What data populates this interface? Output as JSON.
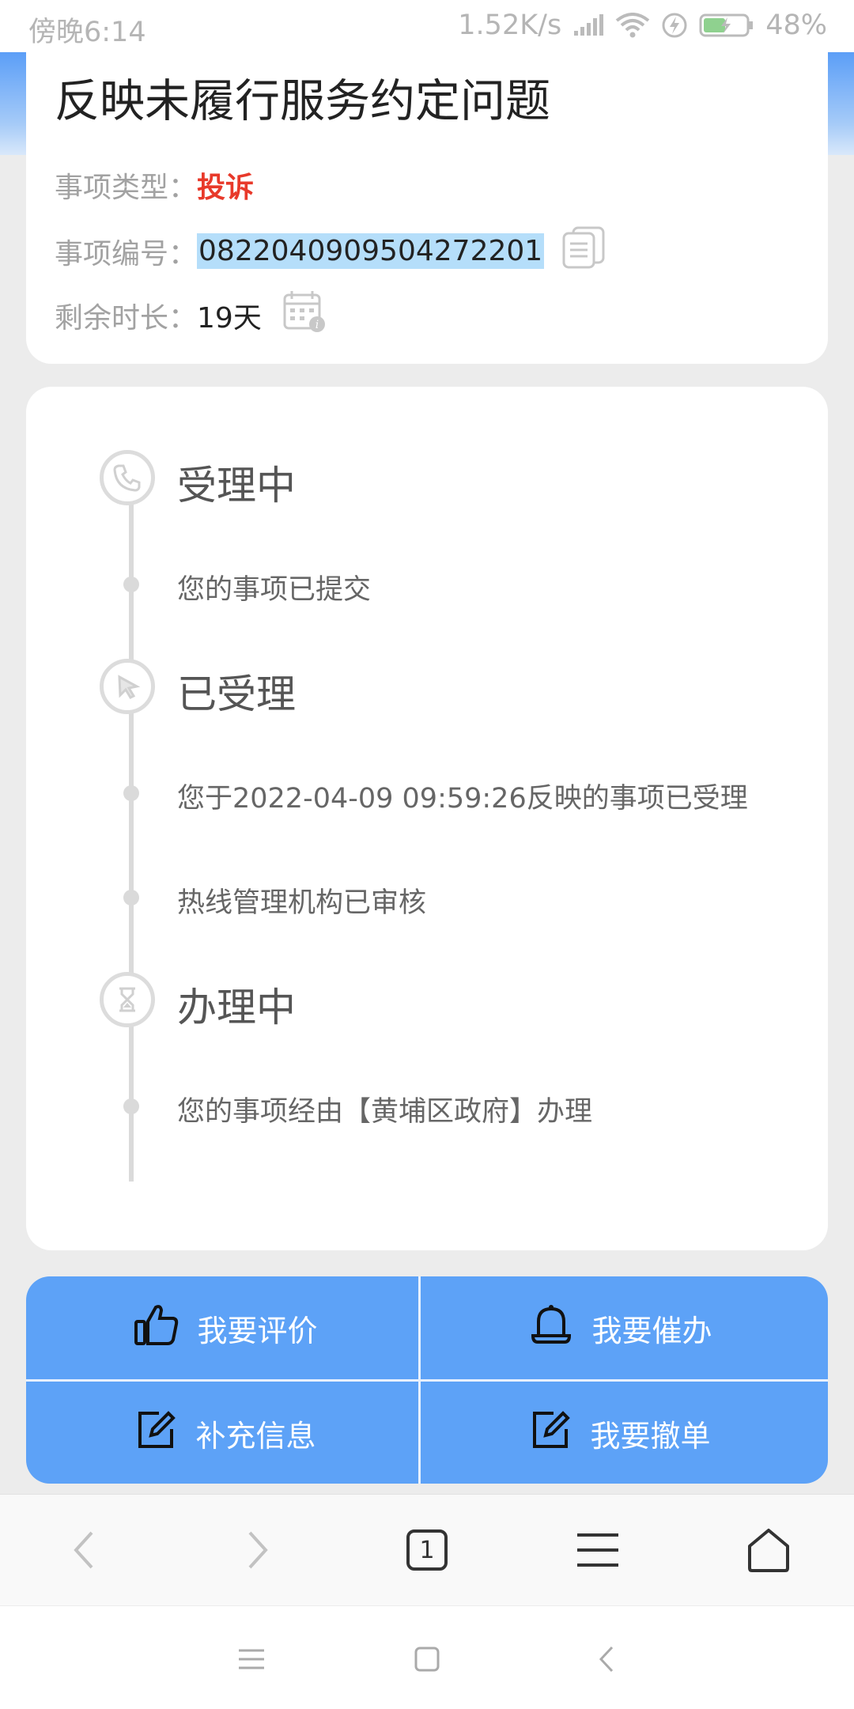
{
  "status_bar": {
    "time": "傍晚6:14",
    "net_speed": "1.52K/s",
    "battery": "48%"
  },
  "issue": {
    "title": "反映未履行服务约定问题",
    "type_label": "事项类型：",
    "type_value": "投诉",
    "number_label": "事项编号：",
    "number_value": "0822040909504272201",
    "remaining_label": "剩余时长：",
    "remaining_value": "19天"
  },
  "timeline": {
    "stages": [
      {
        "title": "受理中",
        "icon": "phone-icon",
        "items": [
          "您的事项已提交"
        ]
      },
      {
        "title": "已受理",
        "icon": "cursor-icon",
        "items": [
          "您于2022-04-09 09:59:26反映的事项已受理",
          "热线管理机构已审核"
        ]
      },
      {
        "title": "办理中",
        "icon": "hourglass-icon",
        "items": [
          "您的事项经由【黄埔区政府】办理"
        ]
      }
    ]
  },
  "actions": {
    "rate": "我要评价",
    "urge": "我要催办",
    "supplement": "补充信息",
    "withdraw": "我要撤单"
  },
  "browser_bar": {
    "tab_count": "1"
  },
  "colors": {
    "accent_blue": "#5da2f7",
    "complaint_red": "#e8392a",
    "selection": "#b5defa"
  }
}
